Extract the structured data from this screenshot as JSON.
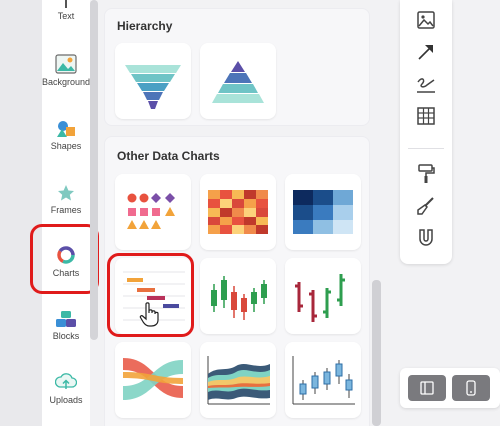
{
  "sidebar": {
    "items": [
      {
        "label": "Text",
        "icon": "text-icon"
      },
      {
        "label": "Background",
        "icon": "background-icon"
      },
      {
        "label": "Shapes",
        "icon": "shapes-icon"
      },
      {
        "label": "Frames",
        "icon": "frames-icon"
      },
      {
        "label": "Charts",
        "icon": "charts-icon",
        "selected": true
      },
      {
        "label": "Blocks",
        "icon": "blocks-icon"
      },
      {
        "label": "Uploads",
        "icon": "uploads-icon"
      }
    ]
  },
  "panel": {
    "sections": [
      {
        "title": "Hierarchy",
        "items": [
          "funnel-chart",
          "pyramid-chart"
        ]
      },
      {
        "title": "Other Data Charts",
        "items": [
          "pictogram-chart",
          "heatmap-warm-chart",
          "heatmap-blue-chart",
          "gantt-chart",
          "candlestick-chart",
          "ohlc-chart",
          "sankey-chart",
          "stream-chart",
          "box-plot-chart"
        ]
      }
    ]
  },
  "toolbar": {
    "tools": [
      "image-icon",
      "arrow-icon",
      "signature-icon",
      "table-icon",
      "paint-roller-icon",
      "brush-icon",
      "magnet-icon"
    ]
  },
  "bottom_bar": {
    "buttons": [
      "panel-left-icon",
      "mobile-icon"
    ]
  },
  "colors": {
    "highlight": "#e01b1b",
    "teal": "#3cb9a6",
    "indigo": "#5b4fa8"
  }
}
